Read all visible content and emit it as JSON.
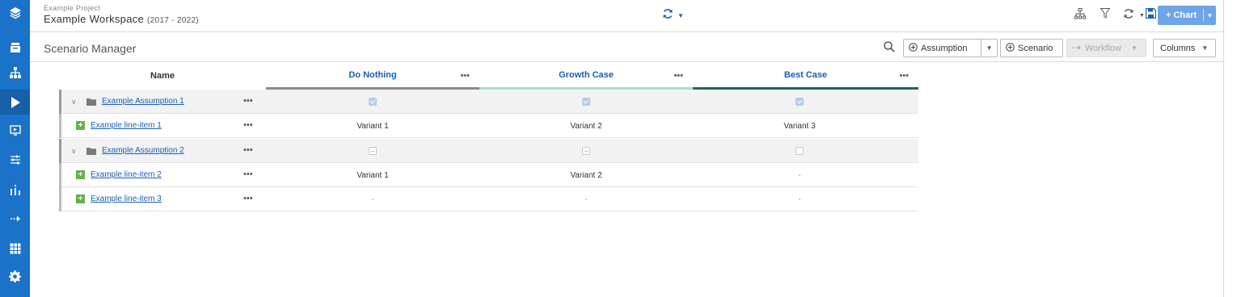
{
  "header": {
    "project": "Example Project",
    "workspace": "Example Workspace",
    "years": "(2017 - 2022)",
    "chart_button": "+ Chart"
  },
  "sidebar": {
    "items": [
      {
        "icon": "layers-icon"
      },
      {
        "icon": "inbox-icon"
      },
      {
        "icon": "hierarchy-icon"
      },
      {
        "icon": "play-icon",
        "active": true
      },
      {
        "icon": "presentation-icon"
      },
      {
        "icon": "sliders-icon"
      },
      {
        "icon": "chart-icon"
      },
      {
        "icon": "arrow-right-icon"
      },
      {
        "icon": "table-icon"
      },
      {
        "icon": "gear-icon"
      }
    ]
  },
  "subbar": {
    "title": "Scenario Manager",
    "assumption_label": "Assumption",
    "scenario_label": "Scenario",
    "workflow_label": "Workflow",
    "columns_label": "Columns"
  },
  "grid": {
    "name_header": "Name",
    "more_glyph": "•••",
    "scenarios": [
      {
        "name": "Do Nothing",
        "color": "#8a8a8a"
      },
      {
        "name": "Growth Case",
        "color": "#a9ddd9"
      },
      {
        "name": "Best Case",
        "color": "#1f6b4f"
      }
    ],
    "rows": [
      {
        "type": "group",
        "name": "Example Assumption 1",
        "values": [
          "checked",
          "checked",
          "checked"
        ]
      },
      {
        "type": "item",
        "name": "Example line-item 1",
        "values": [
          "Variant 1",
          "Variant 2",
          "Variant 3"
        ]
      },
      {
        "type": "group",
        "name": "Example Assumption 2",
        "values": [
          "partial",
          "partial",
          "empty"
        ]
      },
      {
        "type": "item",
        "name": "Example line-item 2",
        "values": [
          "Variant 1",
          "Variant 2",
          "-"
        ]
      },
      {
        "type": "item",
        "name": "Example line-item 3",
        "values": [
          "-",
          "-",
          "-"
        ]
      }
    ]
  },
  "colors": {
    "sidebar": "#1a73c9",
    "link": "#1a5fb4",
    "chart_button": "#6ea5e6"
  }
}
